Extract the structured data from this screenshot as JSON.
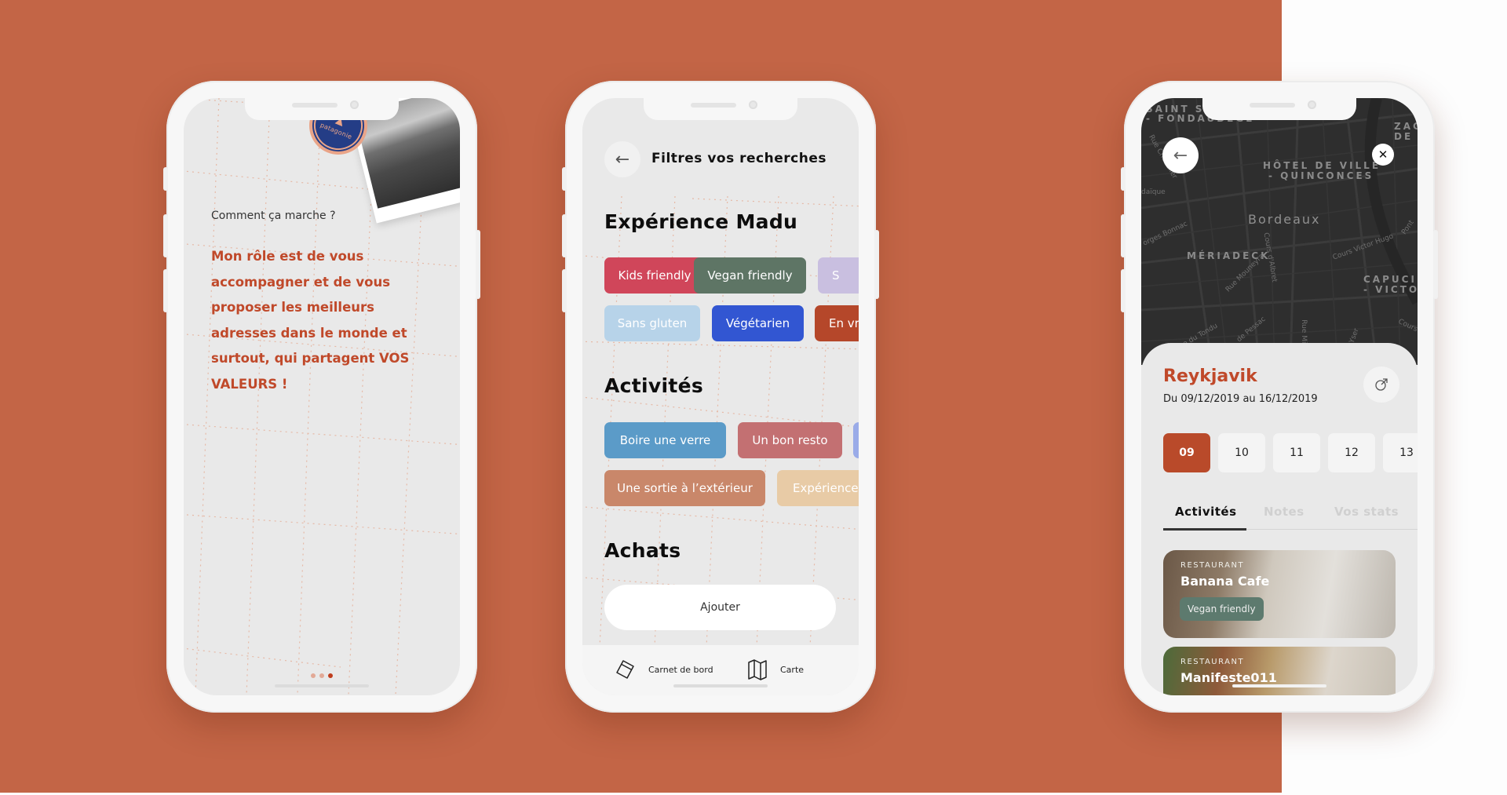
{
  "colors": {
    "background": "#c36546",
    "accent": "#c0492a",
    "screen_bg": "#e9e9e9",
    "map_bg": "#2e2e2e"
  },
  "phone1": {
    "badge_label": "patagonie",
    "question": "Comment ça marche ?",
    "paragraph": "Mon rôle est de vous accompagner et de vous proposer les meilleurs adresses dans le monde et surtout, qui partagent VOS VALEURS !",
    "pager": {
      "total": 3,
      "active_index": 2
    }
  },
  "phone2": {
    "back_icon": "arrow-left-icon",
    "title": "Filtres vos recherches",
    "sections": [
      {
        "heading": "Expérience Madu",
        "chips": [
          {
            "label": "Kids friendly",
            "color": "#d0465a"
          },
          {
            "label": "Vegan friendly",
            "color": "#5e7565"
          },
          {
            "label": "S",
            "color": "#c9bfe0"
          },
          {
            "label": "Sans gluten",
            "color": "#b7d3e9"
          },
          {
            "label": "Végétarien",
            "color": "#3256d2"
          },
          {
            "label": "En vr",
            "color": "#b5472a"
          }
        ]
      },
      {
        "heading": "Activités",
        "chips": [
          {
            "label": "Boire une verre",
            "color": "#5b9bc8"
          },
          {
            "label": "Un bon resto",
            "color": "#c37072"
          },
          {
            "label": "",
            "color": "#9aabe8"
          },
          {
            "label": "Une sortie à l’extérieur",
            "color": "#c9876a"
          },
          {
            "label": "Expérience",
            "color": "#e8cba6"
          }
        ]
      },
      {
        "heading": "Achats",
        "add_button": "Ajouter"
      }
    ],
    "tabbar": [
      {
        "label": "Carnet de bord",
        "icon": "notebook-icon"
      },
      {
        "label": "Carte",
        "icon": "map-icon"
      }
    ]
  },
  "phone3": {
    "map": {
      "city_label": "Bordeaux",
      "districts": [
        "SAINT SE",
        "- FONDAUDEGE",
        "HÔTEL DE VILLE",
        "- QUINCONCES",
        "MÉRIADECK",
        "CAPUCIN",
        "- VICTOI",
        "ZAC",
        "DE"
      ],
      "streets": [
        "Rue Chevalier",
        "daïque",
        "orges Bonnac",
        "Rue Mouneyra",
        "Cours d'Albret",
        "Cours Victor Hugo",
        "Pont",
        "Rue du Tondu",
        "de Pessac",
        "Rue Milli",
        "Yser",
        "Cours de"
      ]
    },
    "back_icon": "arrow-left-icon",
    "close_icon": "close-icon",
    "trip": {
      "city": "Reykjavik",
      "dates": "Du 09/12/2019 au 16/12/2019",
      "share_icon": "external-link-icon"
    },
    "days": [
      {
        "label": "09",
        "active": true
      },
      {
        "label": "10",
        "active": false
      },
      {
        "label": "11",
        "active": false
      },
      {
        "label": "12",
        "active": false
      },
      {
        "label": "13",
        "active": false
      }
    ],
    "tabs": [
      {
        "label": "Activités",
        "active": true
      },
      {
        "label": "Notes",
        "active": false
      },
      {
        "label": "Vos stats",
        "active": false
      }
    ],
    "cards": [
      {
        "type": "RESTAURANT",
        "name": "Banana Cafe",
        "tag": "Vegan friendly"
      },
      {
        "type": "RESTAURANT",
        "name": "Manifeste011",
        "tag": ""
      }
    ]
  }
}
